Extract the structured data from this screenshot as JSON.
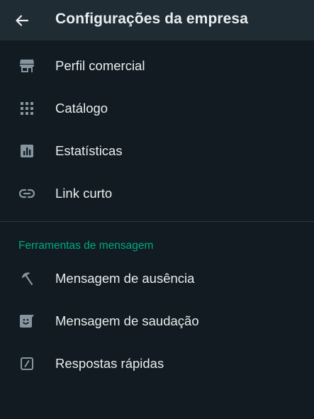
{
  "header": {
    "title": "Configurações da empresa",
    "back_icon": "arrow-left-icon"
  },
  "business_items": [
    {
      "label": "Perfil comercial",
      "icon": "storefront-icon"
    },
    {
      "label": "Catálogo",
      "icon": "grid-icon"
    },
    {
      "label": "Estatísticas",
      "icon": "bar-chart-icon"
    },
    {
      "label": "Link curto",
      "icon": "link-icon"
    }
  ],
  "messaging_section": {
    "title": "Ferramentas de mensagem",
    "items": [
      {
        "label": "Mensagem de ausência",
        "icon": "beach-umbrella-icon"
      },
      {
        "label": "Mensagem de saudação",
        "icon": "smile-message-icon"
      },
      {
        "label": "Respostas rápidas",
        "icon": "quick-reply-icon"
      }
    ]
  },
  "colors": {
    "background": "#111b21",
    "app_bar": "#1f2c34",
    "accent": "#00a884",
    "text_primary": "#e9edef",
    "icon": "#8696a0"
  }
}
